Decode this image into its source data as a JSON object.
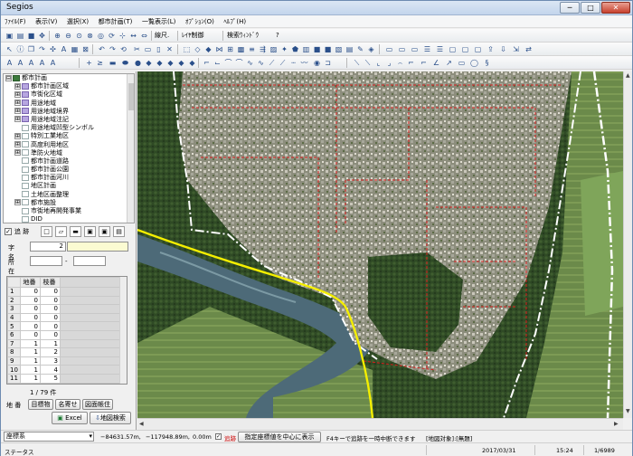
{
  "window": {
    "title": "Segios",
    "min_label": "─",
    "max_label": "□",
    "close_label": "✕"
  },
  "menu": [
    "ﾌｧｲﾙ(F)",
    "表示(V)",
    "選択(X)",
    "都市計画(T)",
    "一覧表示(L)",
    "ｵﾌﾟｼｮﾝ(O)",
    "ﾍﾙﾌﾟ(H)"
  ],
  "toolbar1": {
    "text1": "線尺.",
    "text2": "ﾚｲﾔ制御",
    "text3": "検索ｳｨﾝﾄﾞｳ",
    "help": "?"
  },
  "tree": {
    "items": [
      {
        "label": "都市計画",
        "expander": "⊟",
        "level": 0
      },
      {
        "label": "都市計画区域",
        "expander": "⊞",
        "level": 1
      },
      {
        "label": "市街化区域",
        "expander": "⊞",
        "level": 1
      },
      {
        "label": "用途地域",
        "expander": "⊞",
        "level": 1
      },
      {
        "label": "用途地域境界",
        "expander": "⊞",
        "level": 1
      },
      {
        "label": "用途地域注記",
        "expander": "⊞",
        "level": 1
      },
      {
        "label": "用途地域凹型シンボル",
        "expander": "",
        "level": 1
      },
      {
        "label": "特別工業地区",
        "expander": "⊞",
        "level": 1
      },
      {
        "label": "高度利用地区",
        "expander": "⊞",
        "level": 1
      },
      {
        "label": "準防火地域",
        "expander": "⊞",
        "level": 1
      },
      {
        "label": "都市計画道路",
        "expander": "",
        "level": 1
      },
      {
        "label": "都市計画公園",
        "expander": "",
        "level": 1
      },
      {
        "label": "都市計画河川",
        "expander": "",
        "level": 1
      },
      {
        "label": "地区計画",
        "expander": "",
        "level": 1
      },
      {
        "label": "土地区画整理",
        "expander": "",
        "level": 1
      },
      {
        "label": "都市施設",
        "expander": "⊞",
        "level": 1
      },
      {
        "label": "市街地再開発事業",
        "expander": "",
        "level": 1
      },
      {
        "label": "DID",
        "expander": "",
        "level": 1
      },
      {
        "label": "用途地域マップチップ用",
        "expander": "",
        "level": 1
      },
      {
        "label": "都市計画 印刷用",
        "expander": "⊞",
        "level": 1
      }
    ]
  },
  "display": {
    "label": "追 跡",
    "check": "✓"
  },
  "search": {
    "town_label": "字 名",
    "town_code": "2",
    "town_name": "",
    "location_label": "所 在",
    "location_sep": "-",
    "columns": [
      "地番",
      "枝番"
    ],
    "rows": [
      {
        "no": "1",
        "chiban": "0",
        "edaban": "0"
      },
      {
        "no": "2",
        "chiban": "0",
        "edaban": "0"
      },
      {
        "no": "3",
        "chiban": "0",
        "edaban": "0"
      },
      {
        "no": "4",
        "chiban": "0",
        "edaban": "0"
      },
      {
        "no": "5",
        "chiban": "0",
        "edaban": "0"
      },
      {
        "no": "6",
        "chiban": "0",
        "edaban": "0"
      },
      {
        "no": "7",
        "chiban": "1",
        "edaban": "1"
      },
      {
        "no": "8",
        "chiban": "1",
        "edaban": "2"
      },
      {
        "no": "9",
        "chiban": "1",
        "edaban": "3"
      },
      {
        "no": "10",
        "chiban": "1",
        "edaban": "4"
      },
      {
        "no": "11",
        "chiban": "1",
        "edaban": "5"
      }
    ],
    "count_text": "1 / 79 件",
    "tab_label": "地 番",
    "btn_mokuroku": "目標物",
    "btn_nayose": "名寄せ",
    "btn_zumen": "図面帳住",
    "btn_excel": "Excel",
    "btn_search": "地図検索"
  },
  "coordbar": {
    "system": "座標系",
    "x": "−84631.57m,",
    "y": "−117948.89m,",
    "z": "0.00m",
    "track": "追跡",
    "center_btn": "指定座標値を中心に表示",
    "f4_msg": "F4キーで追跡を一時中断できます",
    "mode": "[地図対象]:[無題]"
  },
  "status": {
    "left": "ステータス",
    "date": "2017/03/31",
    "time": "15:24",
    "scale": "1/6989"
  },
  "colors": {
    "zone_line": "#d81c1c",
    "river_line": "#f4ee00",
    "boundary": "#ffffff"
  }
}
